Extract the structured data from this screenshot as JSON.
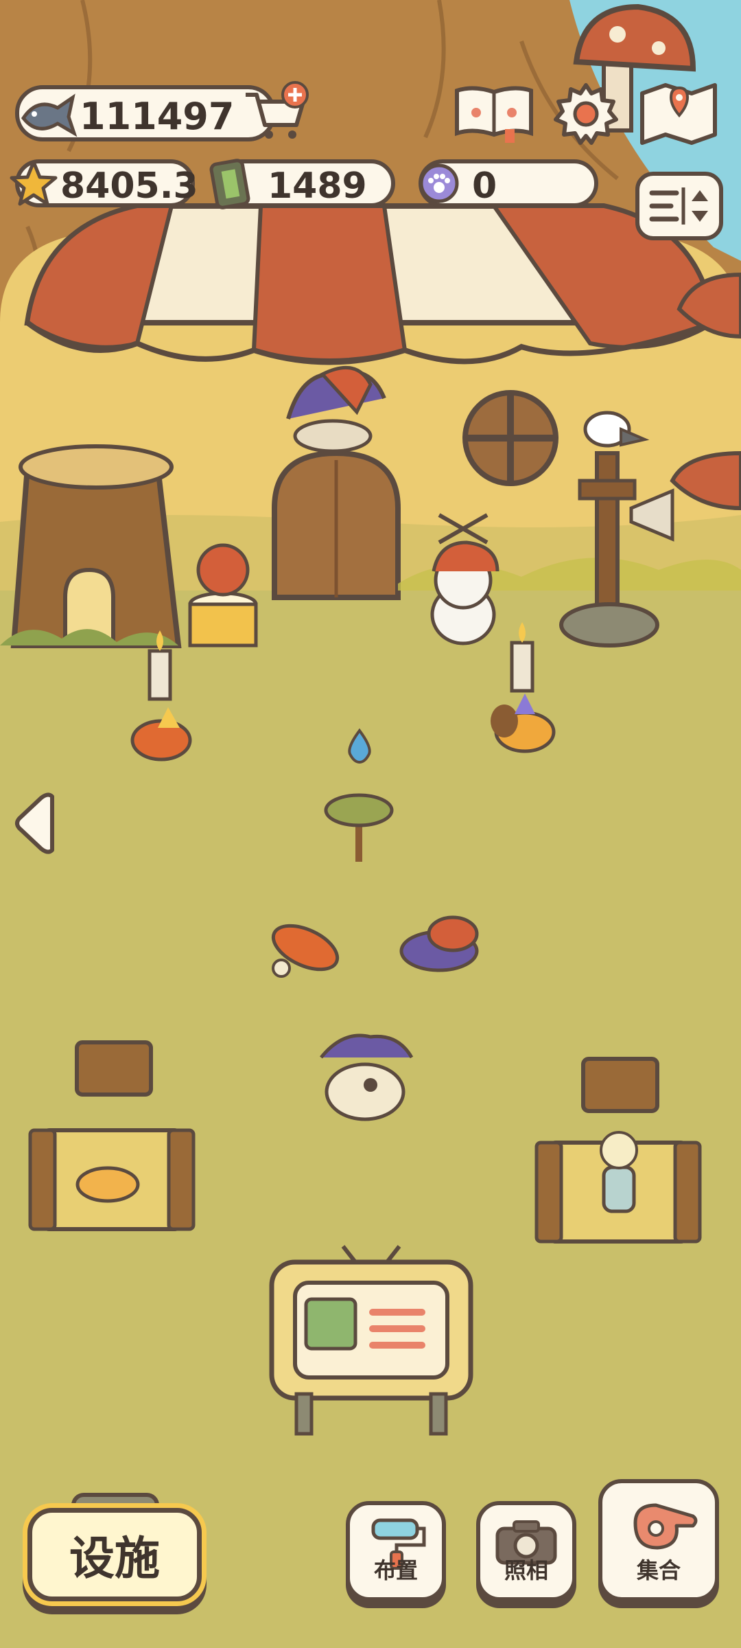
{
  "currencies": {
    "fish": "111497",
    "stars": "8405.3",
    "battery": "1489",
    "paw_tokens": "0"
  },
  "icons": {
    "fish": "fish-icon",
    "cart": "shopping-cart-plus-icon",
    "star": "star-icon",
    "battery": "battery-icon",
    "paw": "paw-coin-icon",
    "book": "paw-book-icon",
    "settings": "gear-icon",
    "map": "map-pin-icon",
    "layout": "layout-toggle-icon",
    "back": "left-arrow-icon",
    "drop": "water-drop-icon"
  },
  "buttons": {
    "facility": "设施",
    "arrange": "布置",
    "photo": "照相",
    "gather": "集合"
  },
  "colors": {
    "ground": "#c9bf6a",
    "outline": "#5b4a3f",
    "pill_bg": "#fdf7ea",
    "awning_red": "#c8623e",
    "awning_cream": "#f7ecd2",
    "sky": "#8fd3e0",
    "accent_yellow": "#f6c94f"
  }
}
